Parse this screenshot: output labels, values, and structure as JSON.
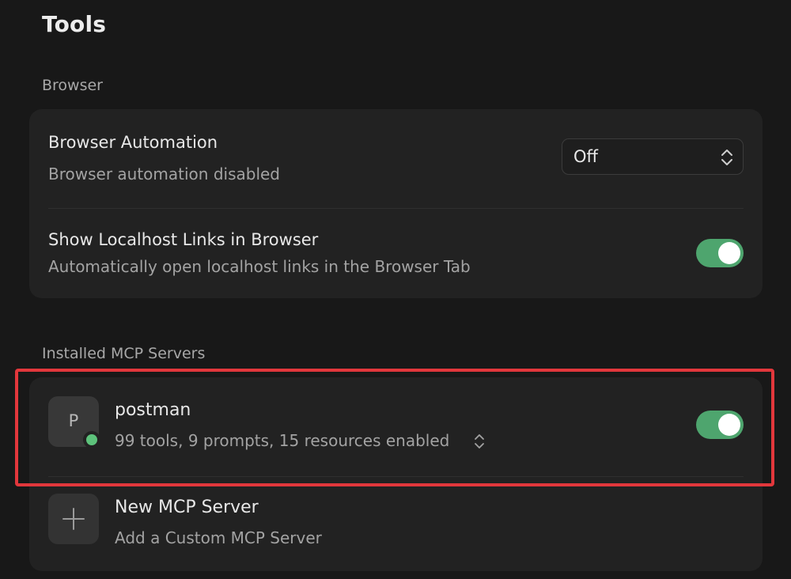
{
  "page": {
    "title": "Tools"
  },
  "browser_section": {
    "label": "Browser",
    "automation": {
      "title": "Browser Automation",
      "subtitle": "Browser automation disabled",
      "select_value": "Off"
    },
    "localhost": {
      "title": "Show Localhost Links in Browser",
      "subtitle": "Automatically open localhost links in the Browser Tab",
      "enabled": true
    }
  },
  "mcp_section": {
    "label": "Installed MCP Servers",
    "servers": [
      {
        "avatar_letter": "P",
        "name": "postman",
        "summary": "99 tools, 9 prompts, 15 resources enabled",
        "enabled": true,
        "status_color": "#5dc27b"
      }
    ],
    "new_server": {
      "title": "New MCP Server",
      "subtitle": "Add a Custom MCP Server"
    }
  },
  "colors": {
    "toggle_on": "#4ea56e",
    "highlight": "#e2373c",
    "background": "#181818",
    "card": "#222222"
  },
  "icons": {
    "select_chevron": "up-down-chevron-icon",
    "expand_chevron": "up-down-chevron-icon",
    "add": "plus-icon"
  }
}
